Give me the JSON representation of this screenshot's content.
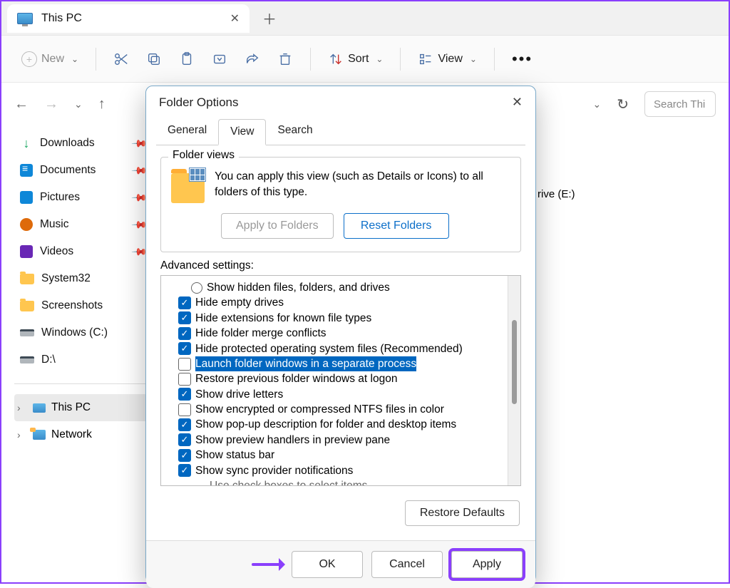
{
  "tab": {
    "title": "This PC"
  },
  "toolbar": {
    "new": "New",
    "sort": "Sort",
    "view": "View"
  },
  "search_placeholder": "Search Thi",
  "sidebar": {
    "items": [
      {
        "label": "Downloads"
      },
      {
        "label": "Documents"
      },
      {
        "label": "Pictures"
      },
      {
        "label": "Music"
      },
      {
        "label": "Videos"
      },
      {
        "label": "System32"
      },
      {
        "label": "Screenshots"
      },
      {
        "label": "Windows (C:)"
      },
      {
        "label": "D:\\"
      }
    ],
    "tree": [
      {
        "label": "This PC"
      },
      {
        "label": "Network"
      }
    ]
  },
  "main": {
    "drive_frag": "rive (E:)"
  },
  "dialog": {
    "title": "Folder Options",
    "tabs": {
      "general": "General",
      "view": "View",
      "search": "Search"
    },
    "folder_views": {
      "legend": "Folder views",
      "desc": "You can apply this view (such as Details or Icons) to all folders of this type.",
      "apply": "Apply to Folders",
      "reset": "Reset Folders"
    },
    "advanced": {
      "label": "Advanced settings:",
      "items": [
        {
          "type": "radio",
          "checked": false,
          "label": "Show hidden files, folders, and drives"
        },
        {
          "type": "check",
          "checked": true,
          "label": "Hide empty drives"
        },
        {
          "type": "check",
          "checked": true,
          "label": "Hide extensions for known file types"
        },
        {
          "type": "check",
          "checked": true,
          "label": "Hide folder merge conflicts"
        },
        {
          "type": "check",
          "checked": true,
          "label": "Hide protected operating system files (Recommended)"
        },
        {
          "type": "check",
          "checked": false,
          "label": "Launch folder windows in a separate process",
          "highlight": true
        },
        {
          "type": "check",
          "checked": false,
          "label": "Restore previous folder windows at logon"
        },
        {
          "type": "check",
          "checked": true,
          "label": "Show drive letters"
        },
        {
          "type": "check",
          "checked": false,
          "label": "Show encrypted or compressed NTFS files in color"
        },
        {
          "type": "check",
          "checked": true,
          "label": "Show pop-up description for folder and desktop items"
        },
        {
          "type": "check",
          "checked": true,
          "label": "Show preview handlers in preview pane"
        },
        {
          "type": "check",
          "checked": true,
          "label": "Show status bar"
        },
        {
          "type": "check",
          "checked": true,
          "label": "Show sync provider notifications"
        }
      ],
      "truncated": "Use check boxes to select items"
    },
    "restore": "Restore Defaults",
    "buttons": {
      "ok": "OK",
      "cancel": "Cancel",
      "apply": "Apply"
    }
  }
}
